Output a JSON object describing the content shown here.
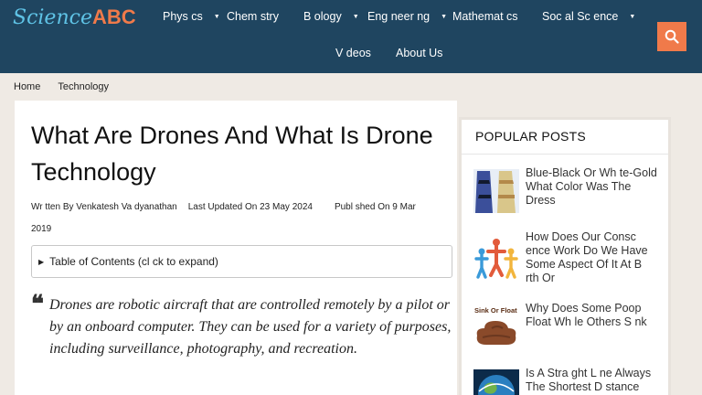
{
  "header": {
    "logo_science": "Science",
    "logo_abc": "ABC",
    "nav": [
      {
        "label": "Phys cs",
        "has_dropdown": true
      },
      {
        "label": "Chem stry",
        "has_dropdown": false
      },
      {
        "label": "B ology",
        "has_dropdown": true
      },
      {
        "label": "Eng neer ng",
        "has_dropdown": true
      },
      {
        "label": "Mathemat cs",
        "has_dropdown": false
      },
      {
        "label": "Soc al Sc ence",
        "has_dropdown": true
      },
      {
        "label": "V deos",
        "has_dropdown": false
      },
      {
        "label": "About Us",
        "has_dropdown": false
      }
    ],
    "search_icon": "search-icon",
    "colors": {
      "bar": "#1f4560",
      "logo_science": "#5fc3e6",
      "accent": "#f07a4a"
    }
  },
  "breadcrumb": {
    "items": [
      "Home",
      "Technology"
    ]
  },
  "article": {
    "title": "What Are Drones And What Is Drone Technology",
    "meta": {
      "written_by": "Wr tten By Venkatesh Va dyanathan",
      "last_updated": "Last Updated On  23 May 2024",
      "published": "Publ shed On  9 Mar",
      "published_year": "2019"
    },
    "toc_label": "Table of Contents (cl ck to expand)",
    "quote": "Drones are robotic aircraft that are controlled remotely by a pilot or by an onboard computer. They can be used for a variety of purposes, including surveillance, photography, and recreation."
  },
  "sidebar": {
    "title": "POPULAR POSTS",
    "posts": [
      {
        "title": "Blue-Black Or Wh te-Gold   What Color Was The Dress",
        "thumb": "dress-thumbnail"
      },
      {
        "title": "How Does Our Consc ence Work   Do We Have Some Aspect Of It At B rth Or",
        "thumb": "people-thumbnail"
      },
      {
        "title": "Why Does Some Poop Float Wh le Others S nk",
        "thumb": "poop-thumbnail",
        "thumb_caption": "Sink Or Float"
      },
      {
        "title": "Is A Stra ght L ne Always The Shortest D stance Between Two Po nts",
        "thumb": "globe-thumbnail"
      }
    ]
  }
}
